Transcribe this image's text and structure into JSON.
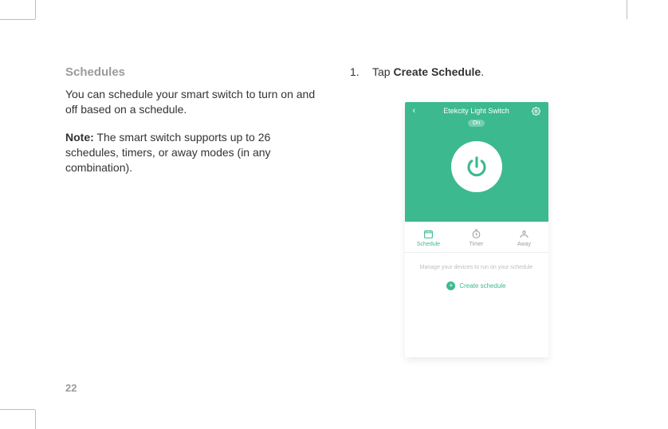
{
  "page_number": "22",
  "left": {
    "heading": "Schedules",
    "intro": "You can schedule your smart switch to turn on and off based on a schedule.",
    "note_label": "Note:",
    "note_body": " The smart switch supports up to 26 schedules, timers, or away modes (in any combination)."
  },
  "right": {
    "step_number": "1.",
    "step_prefix": "Tap ",
    "step_bold": "Create Schedule",
    "step_suffix": "."
  },
  "phone": {
    "title": "Etekcity Light Switch",
    "state": "On",
    "tabs": {
      "schedule": "Schedule",
      "timer": "Timer",
      "away": "Away"
    },
    "hint": "Manage your devices to run on your schedule",
    "create_label": "Create schedule"
  },
  "colors": {
    "accent": "#3cb98f",
    "muted": "#9b9b9b"
  }
}
